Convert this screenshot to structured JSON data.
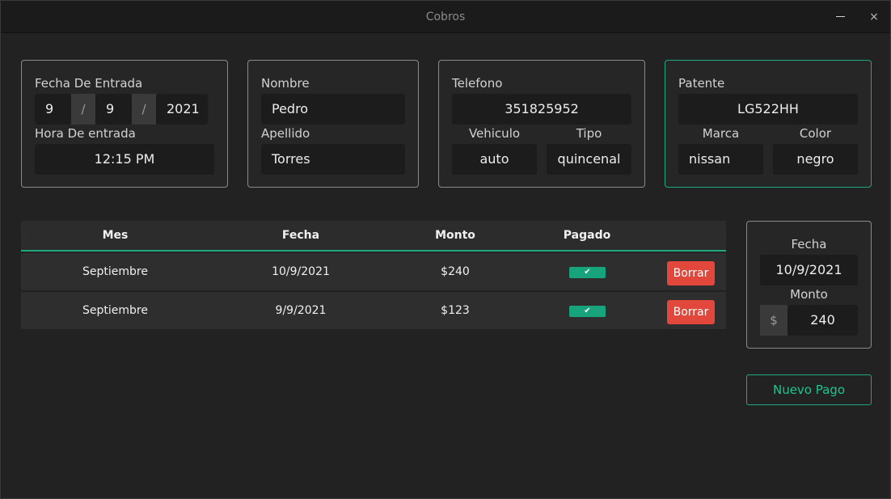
{
  "window": {
    "title": "Cobros",
    "minimize": "",
    "close": "×"
  },
  "entrada": {
    "fecha_label": "Fecha De Entrada",
    "day": "9",
    "month": "9",
    "year": "2021",
    "sep": "/",
    "hora_label": "Hora De entrada",
    "hora": "12:15 PM"
  },
  "persona": {
    "nombre_label": "Nombre",
    "nombre": "Pedro",
    "apellido_label": "Apellido",
    "apellido": "Torres"
  },
  "contacto": {
    "telefono_label": "Telefono",
    "telefono": "351825952",
    "vehiculo_label": "Vehiculo",
    "vehiculo": "auto",
    "tipo_label": "Tipo",
    "tipo": "quincenal"
  },
  "auto": {
    "patente_label": "Patente",
    "patente": "LG522HH",
    "marca_label": "Marca",
    "marca": "nissan",
    "color_label": "Color",
    "color": "negro"
  },
  "table": {
    "headers": [
      "Mes",
      "Fecha",
      "Monto",
      "Pagado"
    ],
    "rows": [
      {
        "mes": "Septiembre",
        "fecha": "10/9/2021",
        "monto": "$240",
        "pagado": "✔",
        "action": "Borrar"
      },
      {
        "mes": "Septiembre",
        "fecha": "9/9/2021",
        "monto": "$123",
        "pagado": "✔",
        "action": "Borrar"
      }
    ]
  },
  "pago": {
    "fecha_label": "Fecha",
    "fecha": "10/9/2021",
    "monto_label": "Monto",
    "currency": "$",
    "monto": "240",
    "button": "Nuevo Pago"
  },
  "colors": {
    "accent": "#1fa87f",
    "danger": "#e2473b",
    "background": "#222222"
  }
}
